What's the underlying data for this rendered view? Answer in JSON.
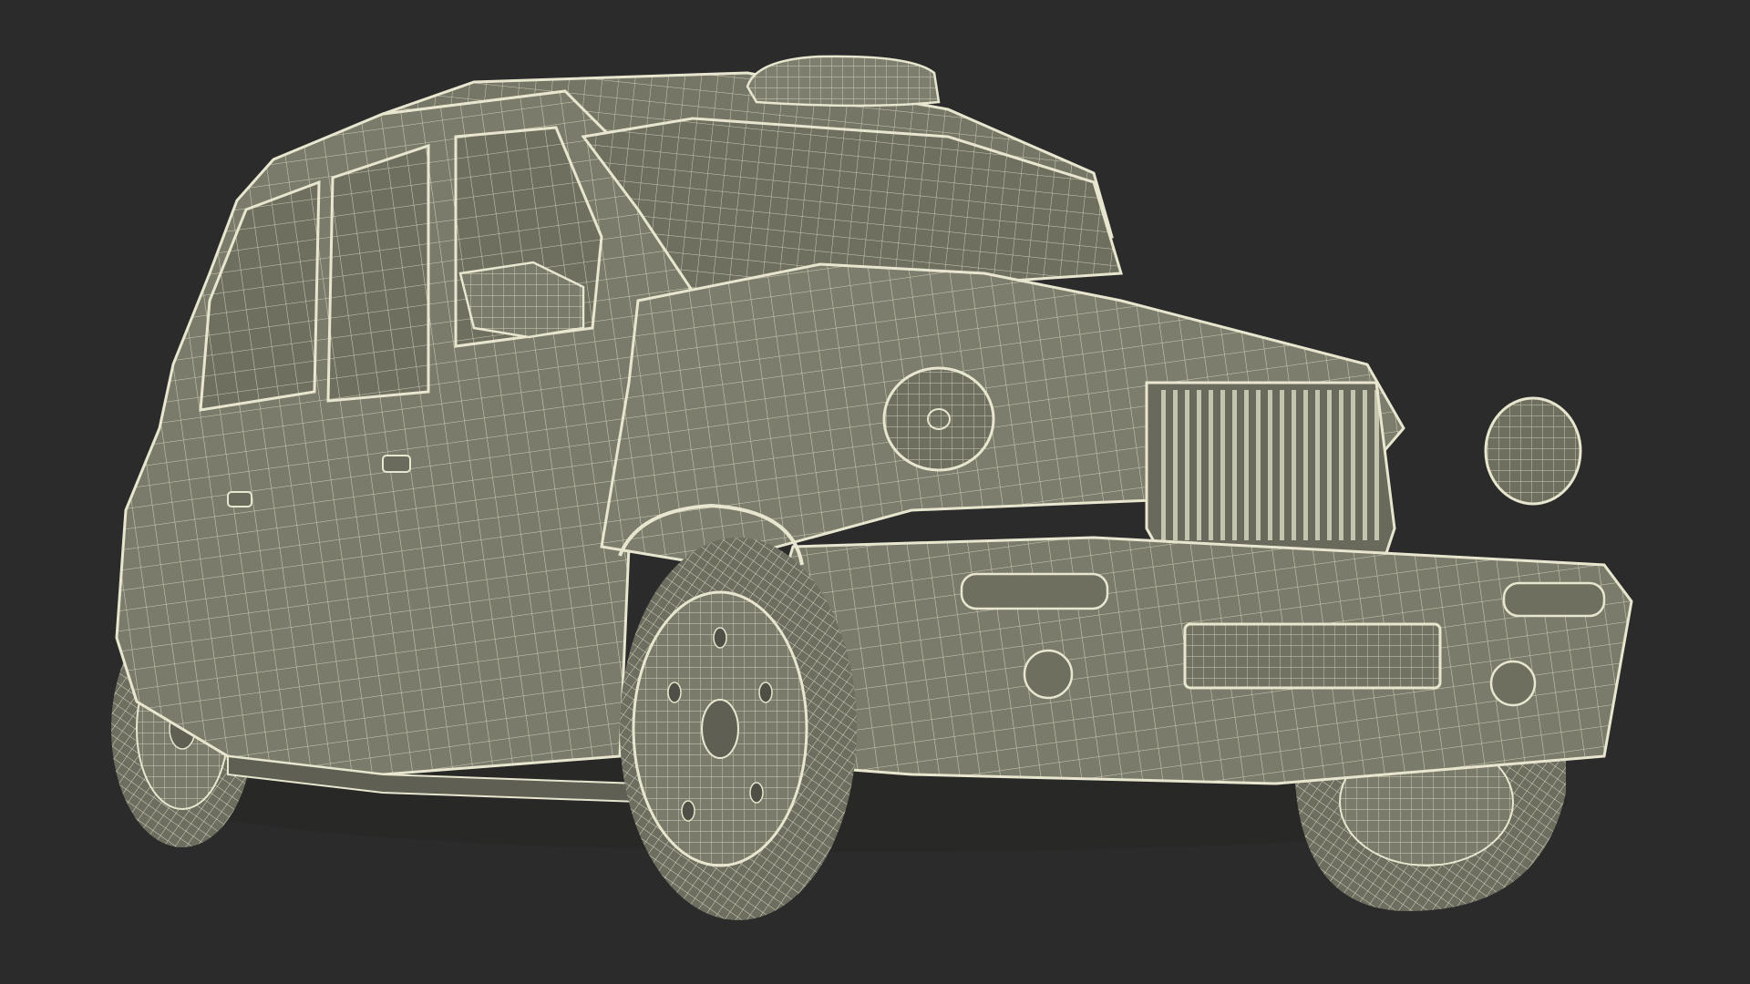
{
  "scene": {
    "subject": "taxi-cab-wireframe",
    "colors": {
      "background": "#2b2b2b",
      "surface": "#7b7b6b",
      "surface_dark": "#5f5f53",
      "wire": "#e8e6cf",
      "wire_soft": "#cfcdb6",
      "shadow": "#444440"
    }
  }
}
